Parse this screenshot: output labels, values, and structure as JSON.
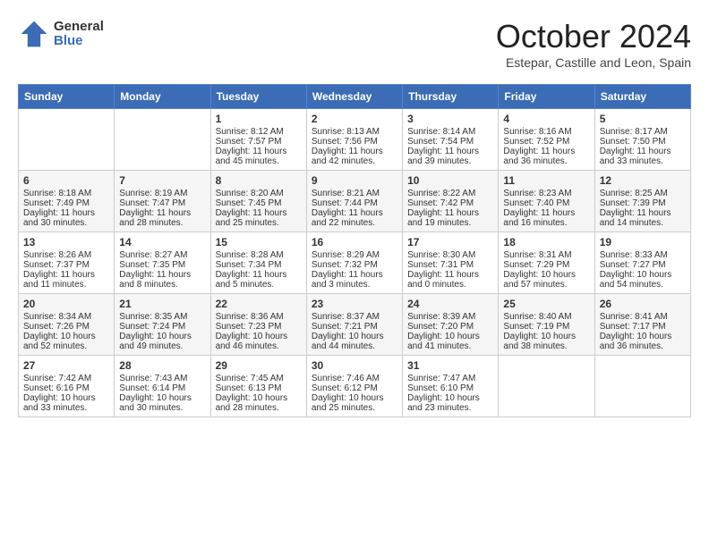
{
  "header": {
    "logo": {
      "general": "General",
      "blue": "Blue"
    },
    "title": "October 2024",
    "subtitle": "Estepar, Castille and Leon, Spain"
  },
  "weekdays": [
    "Sunday",
    "Monday",
    "Tuesday",
    "Wednesday",
    "Thursday",
    "Friday",
    "Saturday"
  ],
  "weeks": [
    [
      {
        "day": null
      },
      {
        "day": null
      },
      {
        "day": "1",
        "sunrise": "Sunrise: 8:12 AM",
        "sunset": "Sunset: 7:57 PM",
        "daylight": "Daylight: 11 hours and 45 minutes."
      },
      {
        "day": "2",
        "sunrise": "Sunrise: 8:13 AM",
        "sunset": "Sunset: 7:56 PM",
        "daylight": "Daylight: 11 hours and 42 minutes."
      },
      {
        "day": "3",
        "sunrise": "Sunrise: 8:14 AM",
        "sunset": "Sunset: 7:54 PM",
        "daylight": "Daylight: 11 hours and 39 minutes."
      },
      {
        "day": "4",
        "sunrise": "Sunrise: 8:16 AM",
        "sunset": "Sunset: 7:52 PM",
        "daylight": "Daylight: 11 hours and 36 minutes."
      },
      {
        "day": "5",
        "sunrise": "Sunrise: 8:17 AM",
        "sunset": "Sunset: 7:50 PM",
        "daylight": "Daylight: 11 hours and 33 minutes."
      }
    ],
    [
      {
        "day": "6",
        "sunrise": "Sunrise: 8:18 AM",
        "sunset": "Sunset: 7:49 PM",
        "daylight": "Daylight: 11 hours and 30 minutes."
      },
      {
        "day": "7",
        "sunrise": "Sunrise: 8:19 AM",
        "sunset": "Sunset: 7:47 PM",
        "daylight": "Daylight: 11 hours and 28 minutes."
      },
      {
        "day": "8",
        "sunrise": "Sunrise: 8:20 AM",
        "sunset": "Sunset: 7:45 PM",
        "daylight": "Daylight: 11 hours and 25 minutes."
      },
      {
        "day": "9",
        "sunrise": "Sunrise: 8:21 AM",
        "sunset": "Sunset: 7:44 PM",
        "daylight": "Daylight: 11 hours and 22 minutes."
      },
      {
        "day": "10",
        "sunrise": "Sunrise: 8:22 AM",
        "sunset": "Sunset: 7:42 PM",
        "daylight": "Daylight: 11 hours and 19 minutes."
      },
      {
        "day": "11",
        "sunrise": "Sunrise: 8:23 AM",
        "sunset": "Sunset: 7:40 PM",
        "daylight": "Daylight: 11 hours and 16 minutes."
      },
      {
        "day": "12",
        "sunrise": "Sunrise: 8:25 AM",
        "sunset": "Sunset: 7:39 PM",
        "daylight": "Daylight: 11 hours and 14 minutes."
      }
    ],
    [
      {
        "day": "13",
        "sunrise": "Sunrise: 8:26 AM",
        "sunset": "Sunset: 7:37 PM",
        "daylight": "Daylight: 11 hours and 11 minutes."
      },
      {
        "day": "14",
        "sunrise": "Sunrise: 8:27 AM",
        "sunset": "Sunset: 7:35 PM",
        "daylight": "Daylight: 11 hours and 8 minutes."
      },
      {
        "day": "15",
        "sunrise": "Sunrise: 8:28 AM",
        "sunset": "Sunset: 7:34 PM",
        "daylight": "Daylight: 11 hours and 5 minutes."
      },
      {
        "day": "16",
        "sunrise": "Sunrise: 8:29 AM",
        "sunset": "Sunset: 7:32 PM",
        "daylight": "Daylight: 11 hours and 3 minutes."
      },
      {
        "day": "17",
        "sunrise": "Sunrise: 8:30 AM",
        "sunset": "Sunset: 7:31 PM",
        "daylight": "Daylight: 11 hours and 0 minutes."
      },
      {
        "day": "18",
        "sunrise": "Sunrise: 8:31 AM",
        "sunset": "Sunset: 7:29 PM",
        "daylight": "Daylight: 10 hours and 57 minutes."
      },
      {
        "day": "19",
        "sunrise": "Sunrise: 8:33 AM",
        "sunset": "Sunset: 7:27 PM",
        "daylight": "Daylight: 10 hours and 54 minutes."
      }
    ],
    [
      {
        "day": "20",
        "sunrise": "Sunrise: 8:34 AM",
        "sunset": "Sunset: 7:26 PM",
        "daylight": "Daylight: 10 hours and 52 minutes."
      },
      {
        "day": "21",
        "sunrise": "Sunrise: 8:35 AM",
        "sunset": "Sunset: 7:24 PM",
        "daylight": "Daylight: 10 hours and 49 minutes."
      },
      {
        "day": "22",
        "sunrise": "Sunrise: 8:36 AM",
        "sunset": "Sunset: 7:23 PM",
        "daylight": "Daylight: 10 hours and 46 minutes."
      },
      {
        "day": "23",
        "sunrise": "Sunrise: 8:37 AM",
        "sunset": "Sunset: 7:21 PM",
        "daylight": "Daylight: 10 hours and 44 minutes."
      },
      {
        "day": "24",
        "sunrise": "Sunrise: 8:39 AM",
        "sunset": "Sunset: 7:20 PM",
        "daylight": "Daylight: 10 hours and 41 minutes."
      },
      {
        "day": "25",
        "sunrise": "Sunrise: 8:40 AM",
        "sunset": "Sunset: 7:19 PM",
        "daylight": "Daylight: 10 hours and 38 minutes."
      },
      {
        "day": "26",
        "sunrise": "Sunrise: 8:41 AM",
        "sunset": "Sunset: 7:17 PM",
        "daylight": "Daylight: 10 hours and 36 minutes."
      }
    ],
    [
      {
        "day": "27",
        "sunrise": "Sunrise: 7:42 AM",
        "sunset": "Sunset: 6:16 PM",
        "daylight": "Daylight: 10 hours and 33 minutes."
      },
      {
        "day": "28",
        "sunrise": "Sunrise: 7:43 AM",
        "sunset": "Sunset: 6:14 PM",
        "daylight": "Daylight: 10 hours and 30 minutes."
      },
      {
        "day": "29",
        "sunrise": "Sunrise: 7:45 AM",
        "sunset": "Sunset: 6:13 PM",
        "daylight": "Daylight: 10 hours and 28 minutes."
      },
      {
        "day": "30",
        "sunrise": "Sunrise: 7:46 AM",
        "sunset": "Sunset: 6:12 PM",
        "daylight": "Daylight: 10 hours and 25 minutes."
      },
      {
        "day": "31",
        "sunrise": "Sunrise: 7:47 AM",
        "sunset": "Sunset: 6:10 PM",
        "daylight": "Daylight: 10 hours and 23 minutes."
      },
      {
        "day": null
      },
      {
        "day": null
      }
    ]
  ]
}
